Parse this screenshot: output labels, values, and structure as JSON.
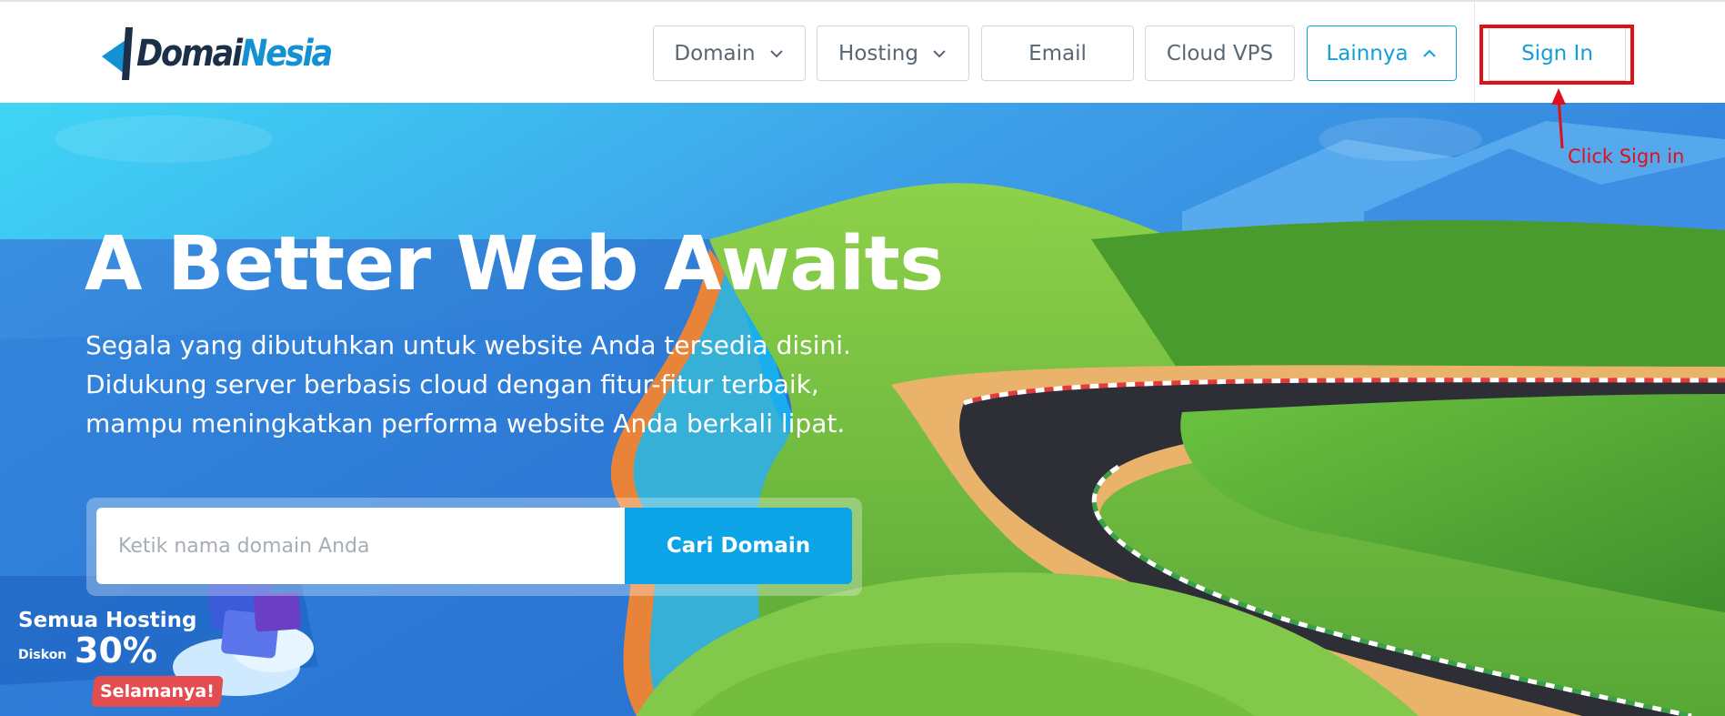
{
  "brand": {
    "logo_text_main": "Domai",
    "logo_text_accent": "Nesia",
    "logo_icon": "domainesia-logo-icon"
  },
  "nav": {
    "items": [
      {
        "label": "Domain",
        "has_dropdown": true,
        "icon": "chevron-down-icon"
      },
      {
        "label": "Hosting",
        "has_dropdown": true,
        "icon": "chevron-down-icon"
      },
      {
        "label": "Email",
        "has_dropdown": false
      },
      {
        "label": "Cloud VPS",
        "has_dropdown": false
      },
      {
        "label": "Lainnya",
        "has_dropdown": true,
        "expanded": true,
        "icon": "chevron-up-icon"
      }
    ],
    "signin_label": "Sign In"
  },
  "annotation": {
    "text": "Click Sign in",
    "color": "#e0101b"
  },
  "hero": {
    "title": "A Better Web Awaits",
    "subtitle_lines": [
      "Segala yang dibutuhkan untuk website Anda tersedia disini.",
      "Didukung server berbasis cloud dengan fitur-fitur terbaik,",
      "mampu meningkatkan performa website Anda berkali lipat."
    ],
    "search": {
      "placeholder": "Ketik nama domain Anda",
      "button_label": "Cari Domain"
    }
  },
  "promo": {
    "line1": "Semua Hosting",
    "diskon_label": "Diskon",
    "percent": "30%",
    "ribbon": "Selamanya!"
  },
  "colors": {
    "accent": "#0ba4e6",
    "brand_dark": "#1b2f48",
    "brand_blue": "#1391d3",
    "highlight": "#e0101b"
  }
}
